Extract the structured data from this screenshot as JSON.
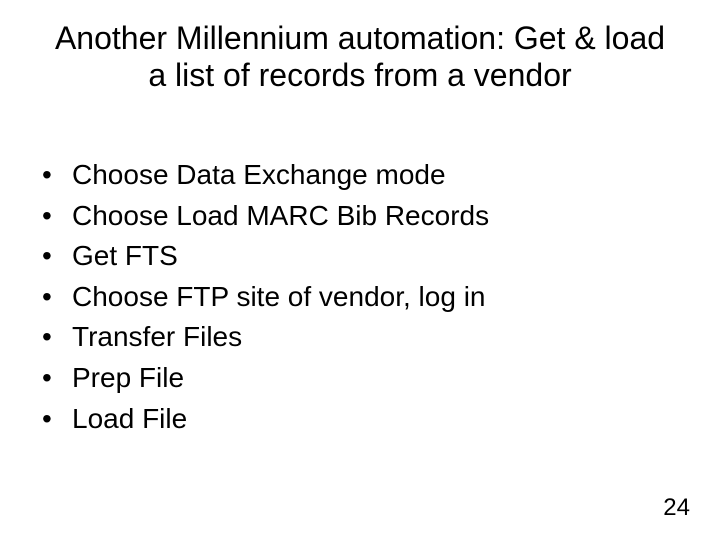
{
  "title": "Another Millennium automation: Get & load a list of records from a vendor",
  "bullets": [
    "Choose Data Exchange mode",
    "Choose Load MARC Bib Records",
    "Get FTS",
    "Choose FTP site of vendor, log in",
    "Transfer Files",
    "Prep File",
    "Load File"
  ],
  "pageNumber": "24"
}
